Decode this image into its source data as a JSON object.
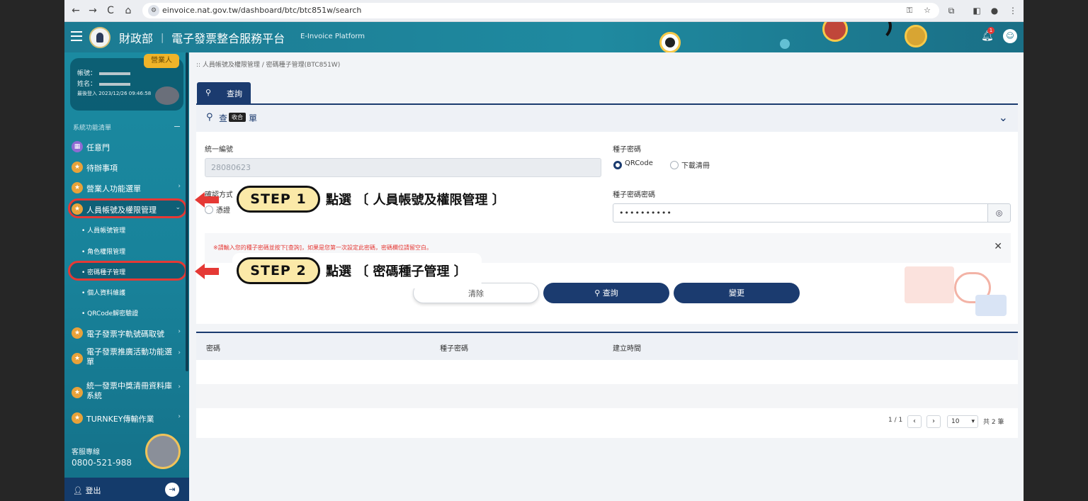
{
  "browser": {
    "url": "einvoice.nat.gov.tw/dashboard/btc/btc851w/search",
    "nav": [
      "←",
      "→",
      "C",
      "⌂"
    ]
  },
  "header": {
    "brand": "財政部 ︱ 電子發票整合服務平台",
    "brand_en": "E-Invoice Platform",
    "notification_count": "1"
  },
  "sidebar": {
    "profile_tag": "營業人",
    "account_label": "帳號：",
    "name_label": "姓名：",
    "last_login": "最後登入 2023/12/26 09:46:58",
    "section_title": "系統功能清單",
    "items": [
      {
        "label": "任意門",
        "icon": "▦"
      },
      {
        "label": "待辦事項",
        "icon": "★"
      },
      {
        "label": "營業人功能選單",
        "icon": "★"
      },
      {
        "label": "人員帳號及權限管理",
        "icon": "★"
      }
    ],
    "sub_items": [
      "人員帳號管理",
      "角色權限管理",
      "密碼種子管理",
      "個人資料維護",
      "QRCode解密驗證"
    ],
    "more_items": [
      {
        "label": "電子發票字軌號碼取號",
        "icon": "★"
      },
      {
        "label": "電子發票推廣活動功能選單",
        "icon": "★"
      },
      {
        "label": "統一發票中獎清冊資料庫系統",
        "icon": "★"
      },
      {
        "label": "TURNKEY傳輸作業",
        "icon": "★"
      }
    ],
    "hotline_label": "客服專線",
    "hotline_number": "0800-521-988",
    "logout": "登出"
  },
  "breadcrumb": ":: 人員帳號及權限管理 / 密碼種子管理(BTC851W)",
  "tab_label": "查詢",
  "panel": {
    "title_left": "查",
    "tooltip": "收合",
    "title_right": "單",
    "ubn_label": "統一編號",
    "ubn_value": "28080623",
    "seed_label": "種子密碼",
    "radio_qrcode": "QRCode",
    "radio_download": "下載清冊",
    "confirm_label": "確認方式",
    "confirm_option": "憑證",
    "seed_pwd_label": "種子密碼密碼",
    "seed_pwd_value": "••••••••••",
    "notice": "※請輸入您的種子密碼並按下[查詢]，如果是您第一次設定此密碼，密碼欄位請留空白。",
    "btn_clear": "清除",
    "btn_query": "查詢",
    "btn_change": "變更"
  },
  "table": {
    "headers": [
      "密碼",
      "種子密碼",
      "建立時間"
    ],
    "page_info": "1 / 1",
    "page_size": "10",
    "total": "共 2 筆"
  },
  "annotations": {
    "step1_pill": "STEP 1",
    "step1_text": "點選 〔 人員帳號及權限管理 〕",
    "step2_pill": "STEP 2",
    "step2_text": "點選 〔 密碼種子管理 〕"
  },
  "colors": {
    "primary": "#1b3b6f",
    "teal": "#1b8aa1",
    "highlight": "#e53935"
  }
}
